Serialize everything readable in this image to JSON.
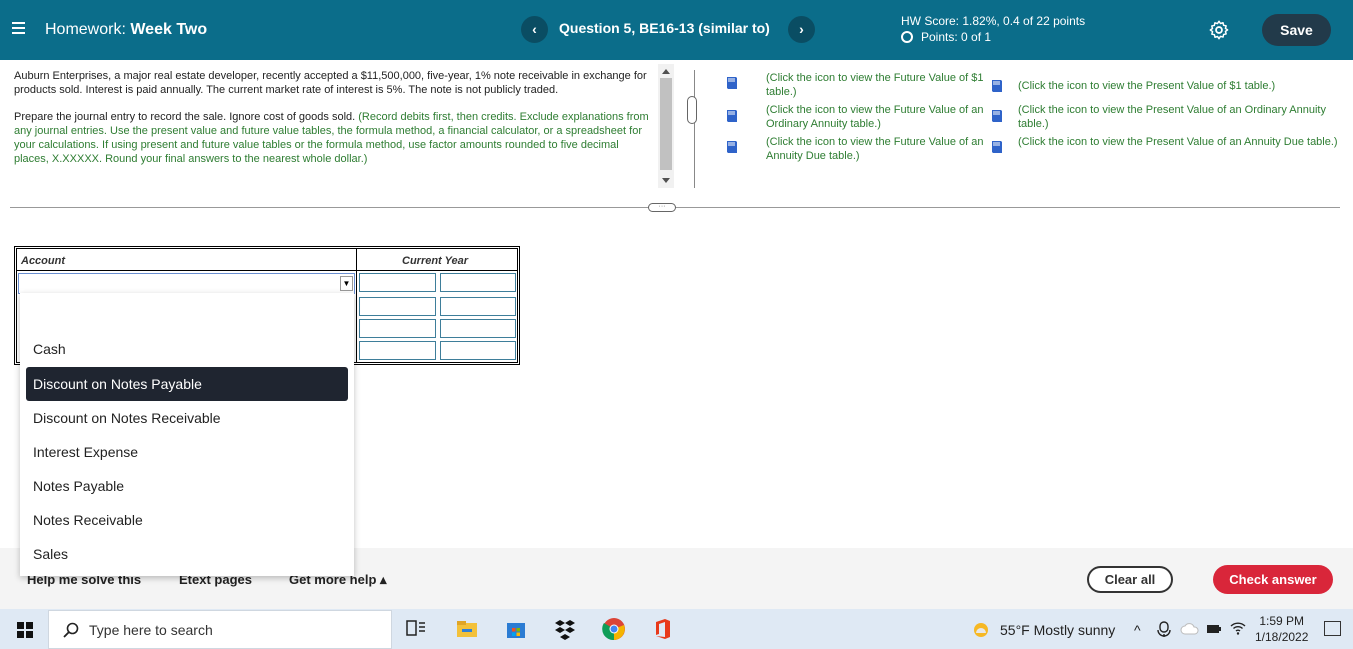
{
  "header": {
    "menu_icon": "hamburger-icon",
    "hw_prefix": "Homework:",
    "hw_name": "Week Two",
    "prev_icon": "chevron-left-icon",
    "next_icon": "chevron-right-icon",
    "question_title": "Question 5, BE16-13 (similar to)",
    "hw_score": "HW Score: 1.82%, 0.4 of 22 points",
    "points": "Points: 0 of 1",
    "settings_icon": "gear-icon",
    "save_label": "Save"
  },
  "question": {
    "para1": "Auburn Enterprises, a major real estate developer, recently accepted a $11,500,000, five-year, 1% note receivable in exchange for products sold. Interest is paid annually. The current market rate of interest is 5%. The note is not publicly traded.",
    "para2_lead": "Prepare the journal entry to record the sale. Ignore cost of goods sold.",
    "para2_instruction": "(Record debits first, then credits. Exclude explanations from any journal entries. Use the present value and future value tables, the formula method, a financial calculator, or a spreadsheet for your calculations. If using present and future value tables or the formula method, use factor amounts rounded to five decimal places, X.XXXXX. Round your final answers to the nearest whole dollar.)"
  },
  "resources": {
    "left": [
      "(Click the icon to view the Future Value of $1 table.)",
      "(Click the icon to view the Future Value of an Ordinary Annuity table.)",
      "(Click the icon to view the Future Value of an Annuity Due table.)"
    ],
    "right": [
      "(Click the icon to view the Present Value of $1 table.)",
      "(Click the icon to view the Present Value of an Ordinary Annuity table.)",
      "(Click the icon to view the Present Value of an Annuity Due table.)"
    ]
  },
  "table": {
    "account_header": "Account",
    "current_year_header": "Current Year",
    "account_value": ""
  },
  "dropdown": {
    "options": [
      "Cash",
      "Discount on Notes Payable",
      "Discount on Notes Receivable",
      "Interest Expense",
      "Notes Payable",
      "Notes Receivable",
      "Sales"
    ],
    "highlighted": "Discount on Notes Payable"
  },
  "footer": {
    "help_label": "Help me solve this",
    "etext_label": "Etext pages",
    "more_help_label": "Get more help ▴",
    "clear_label": "Clear all",
    "check_label": "Check answer"
  },
  "taskbar": {
    "search_placeholder": "Type here to search",
    "weather": "55°F  Mostly sunny",
    "time": "1:59 PM",
    "date": "1/18/2022"
  },
  "colors": {
    "header_bg": "#0b6d8a",
    "instruction_green": "#2e7d32",
    "check_red": "#d9263a",
    "save_dark": "#223a4a"
  }
}
